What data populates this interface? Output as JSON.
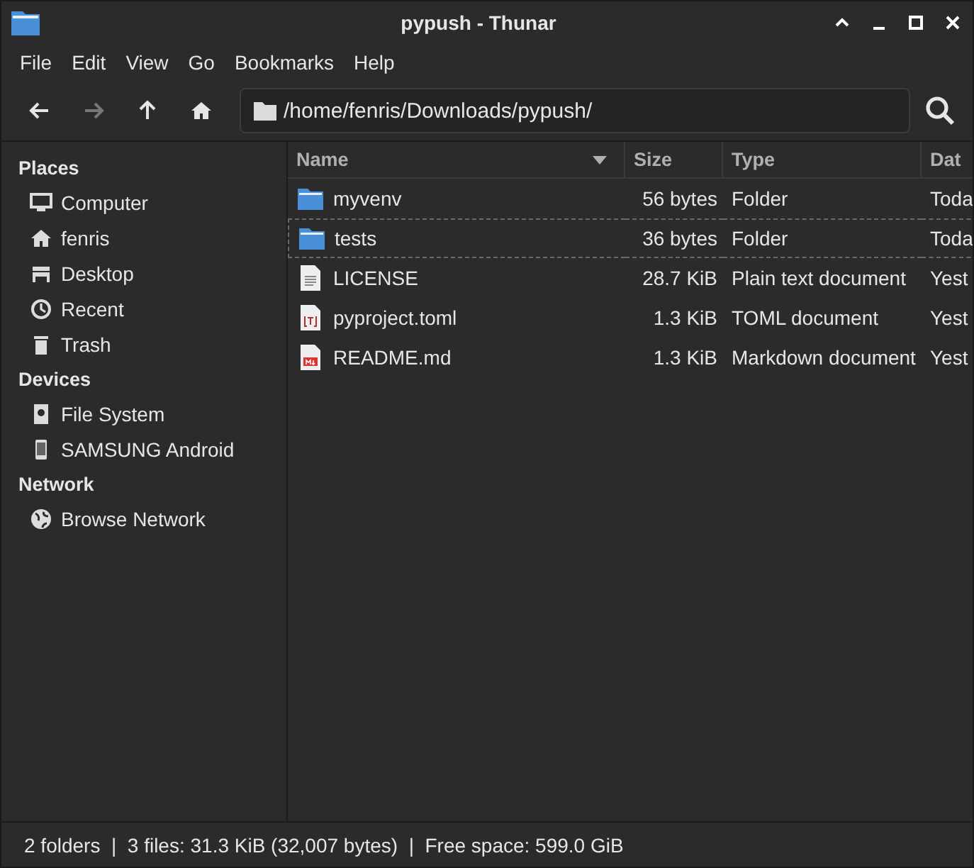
{
  "window": {
    "title": "pypush - Thunar"
  },
  "menu": [
    "File",
    "Edit",
    "View",
    "Go",
    "Bookmarks",
    "Help"
  ],
  "toolbar": {
    "back_disabled": false,
    "forward_disabled": true,
    "location": "/home/fenris/Downloads/pypush/"
  },
  "sidebar": [
    {
      "heading": "Places",
      "items": [
        {
          "label": "Computer",
          "kind": "computer"
        },
        {
          "label": "fenris",
          "kind": "home"
        },
        {
          "label": "Desktop",
          "kind": "desktop"
        },
        {
          "label": "Recent",
          "kind": "recent"
        },
        {
          "label": "Trash",
          "kind": "trash"
        }
      ]
    },
    {
      "heading": "Devices",
      "items": [
        {
          "label": "File System",
          "kind": "disk"
        },
        {
          "label": "SAMSUNG Android",
          "kind": "phone"
        }
      ]
    },
    {
      "heading": "Network",
      "items": [
        {
          "label": "Browse Network",
          "kind": "network"
        }
      ]
    }
  ],
  "table": {
    "columns": [
      "Name",
      "Size",
      "Type",
      "Dat"
    ],
    "rows": [
      {
        "name": "myvenv",
        "size": "56 bytes",
        "type": "Folder",
        "date": "Toda",
        "kind": "folder",
        "focused": false
      },
      {
        "name": "tests",
        "size": "36 bytes",
        "type": "Folder",
        "date": "Toda",
        "kind": "folder",
        "focused": true
      },
      {
        "name": "LICENSE",
        "size": "28.7 KiB",
        "type": "Plain text document",
        "date": "Yest",
        "kind": "text",
        "focused": false
      },
      {
        "name": "pyproject.toml",
        "size": "1.3 KiB",
        "type": "TOML document",
        "date": "Yest",
        "kind": "toml",
        "focused": false
      },
      {
        "name": "README.md",
        "size": "1.3 KiB",
        "type": "Markdown document",
        "date": "Yest",
        "kind": "markdown",
        "focused": false
      }
    ]
  },
  "status_bar": "2 folders  |  3 files: 31.3 KiB (32,007 bytes)  |  Free space: 599.0 GiB"
}
